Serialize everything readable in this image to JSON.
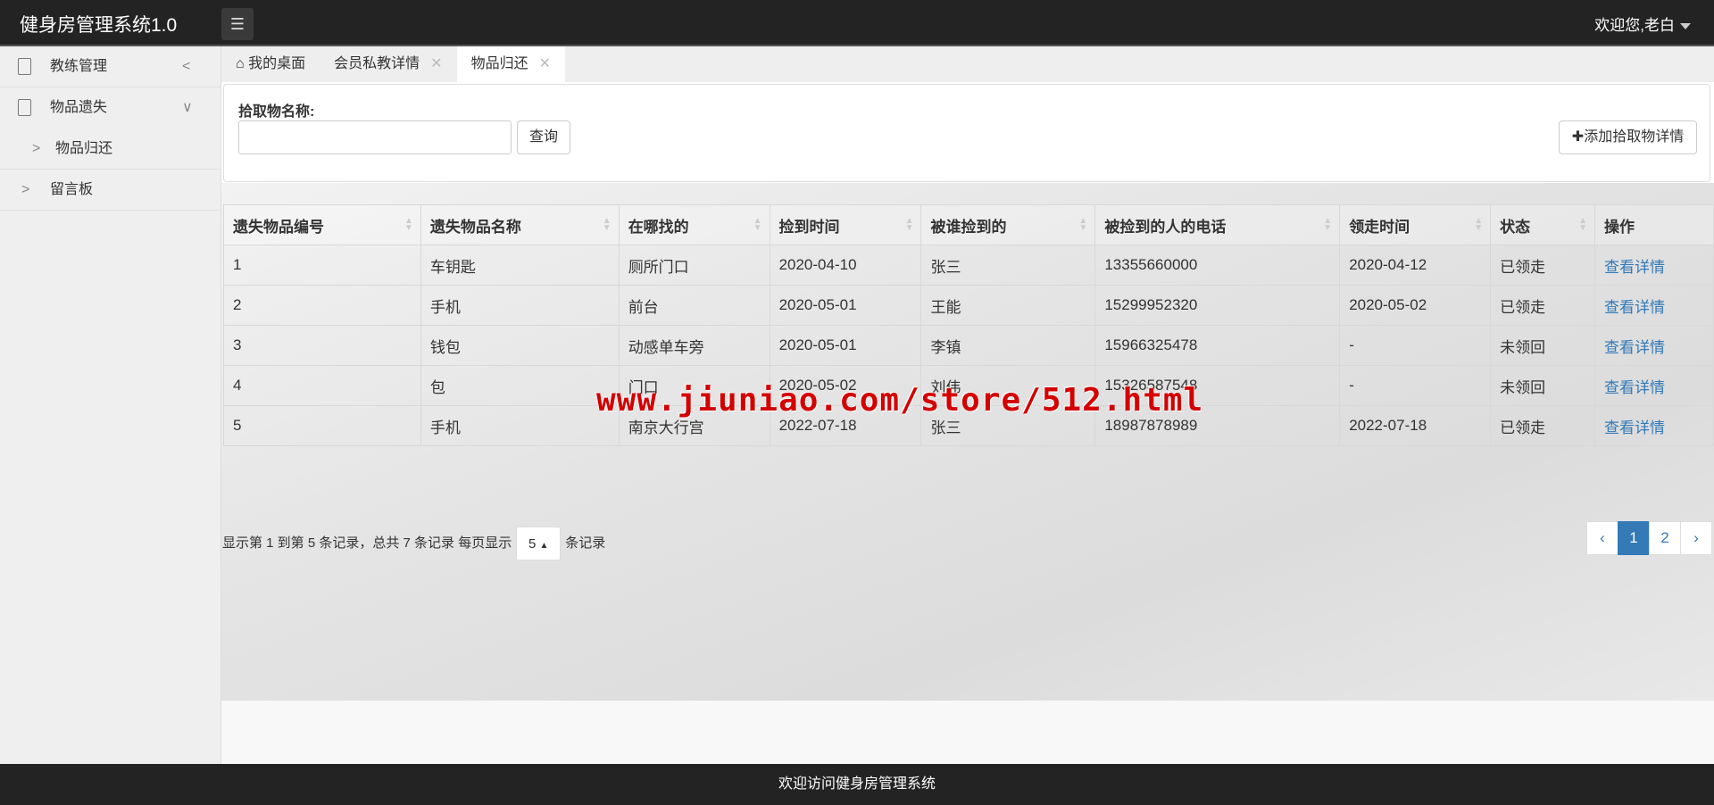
{
  "header": {
    "title": "健身房管理系统1.0",
    "user": "欢迎您,老白",
    "menu_icon": "list-icon"
  },
  "sidebar": {
    "items": [
      {
        "label": "教练管理",
        "arrow": "<"
      },
      {
        "label": "物品遗失",
        "arrow": "∨"
      },
      {
        "label": "物品归还",
        "arrow": ">"
      },
      {
        "label": "留言板",
        "arrow": ">"
      }
    ]
  },
  "tabs": [
    {
      "label": "我的桌面"
    },
    {
      "label": "会员私教详情"
    },
    {
      "label": "物品归还"
    }
  ],
  "search": {
    "label": "拾取物名称:",
    "value": "",
    "query_label": "查询",
    "add_label": "添加拾取物详情"
  },
  "table": {
    "columns": [
      "遗失物品编号",
      "遗失物品名称",
      "在哪找的",
      "捡到时间",
      "被谁捡到的",
      "被捡到的人的电话",
      "领走时间",
      "状态",
      "操作"
    ],
    "rows": [
      [
        "1",
        "车钥匙",
        "厕所门口",
        "2020-04-10",
        "张三",
        "13355660000",
        "2020-04-12",
        "已领走",
        "查看详情"
      ],
      [
        "2",
        "手机",
        "前台",
        "2020-05-01",
        "王能",
        "15299952320",
        "2020-05-02",
        "已领走",
        "查看详情"
      ],
      [
        "3",
        "钱包",
        "动感单车旁",
        "2020-05-01",
        "李镇",
        "15966325478",
        "-",
        "未领回",
        "查看详情"
      ],
      [
        "4",
        "包",
        "门口",
        "2020-05-02",
        "刘伟",
        "15326587548",
        "-",
        "未领回",
        "查看详情"
      ],
      [
        "5",
        "手机",
        "南京大行宫",
        "2022-07-18",
        "张三",
        "18987878989",
        "2022-07-18",
        "已领走",
        "查看详情"
      ]
    ]
  },
  "pagination": {
    "info": "显示第 1 到第 5 条记录，总共 7 条记录 每页显示",
    "page_size": "5",
    "suffix": "条记录",
    "prev": "‹",
    "pages": [
      "1",
      "2"
    ],
    "next": "›",
    "current": "1"
  },
  "footer": {
    "text": "欢迎访问健身房管理系统"
  },
  "watermark": "www.jiuniao.com/store/512.html",
  "colors": {
    "topbar": "#232323",
    "link": "#337ab7",
    "active_page": "#337ab7"
  }
}
